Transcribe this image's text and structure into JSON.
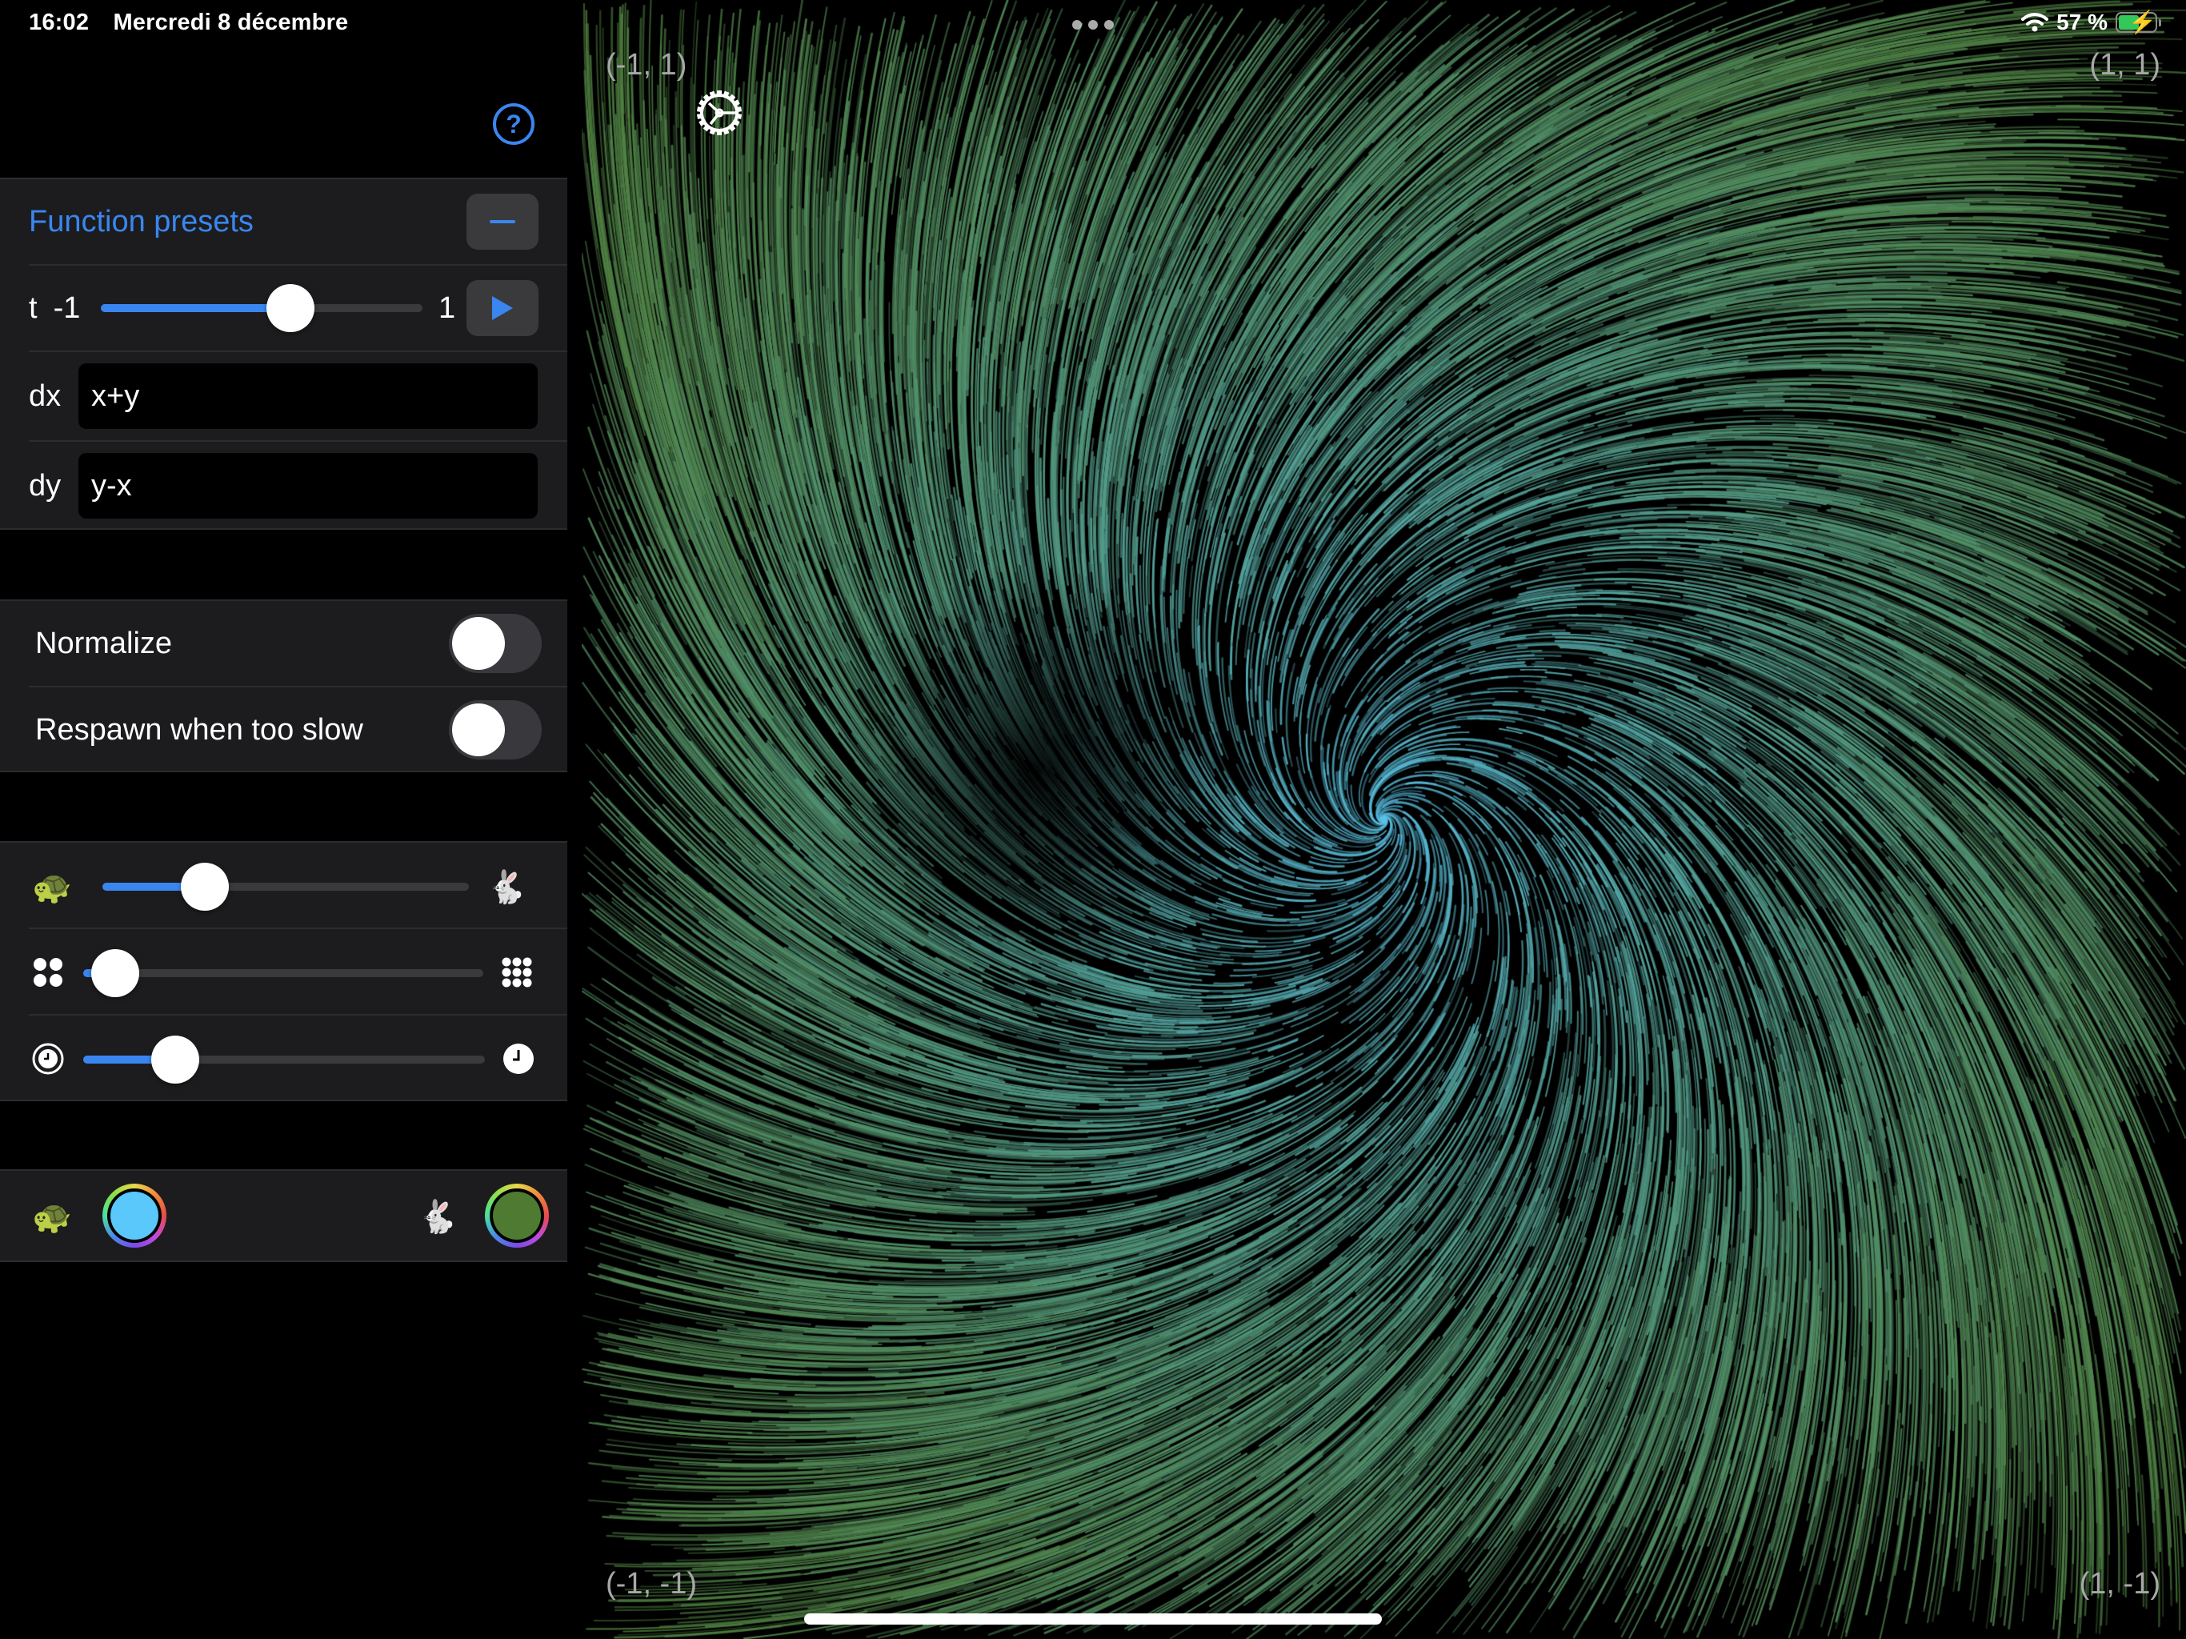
{
  "status_bar": {
    "time": "16:02",
    "date": "Mercredi 8 décembre",
    "battery_percent": "57 %",
    "battery_level": 0.57,
    "charging": true,
    "wifi_icon": "wifi-icon"
  },
  "help_icon": "?",
  "function_section": {
    "presets_label": "Function presets",
    "collapse_button_icon": "minus-icon",
    "t_label": "t",
    "t_min": "-1",
    "t_max": "1",
    "t_value_fraction": 0.59,
    "play_button_icon": "play-icon",
    "dx_label": "dx",
    "dx_value": "x+y",
    "dy_label": "dy",
    "dy_value": "y-x"
  },
  "options_section": {
    "normalize_label": "Normalize",
    "normalize_on": false,
    "respawn_label": "Respawn when too slow",
    "respawn_on": false
  },
  "sliders_section": {
    "speed": {
      "min_icon": "tortoise-icon",
      "max_icon": "hare-icon",
      "value_fraction": 0.28
    },
    "density": {
      "min_icon": "four-dots-icon",
      "max_icon": "nine-dots-icon",
      "value_fraction": 0.08
    },
    "trail": {
      "min_icon": "timer-icon",
      "max_icon": "clock-icon",
      "value_fraction": 0.23
    }
  },
  "colors_section": {
    "slow_icon": "tortoise-icon",
    "slow_color": "#5ac8fa",
    "fast_icon": "hare-icon",
    "fast_color": "#4f7a32"
  },
  "canvas": {
    "corner_top_left": "(-1, 1)",
    "corner_top_right": "(1, 1)",
    "corner_bottom_left": "(-1, -1)",
    "corner_bottom_right": "(1, -1)",
    "settings_icon": "gear-icon"
  },
  "accent_color": "#3a86f0"
}
